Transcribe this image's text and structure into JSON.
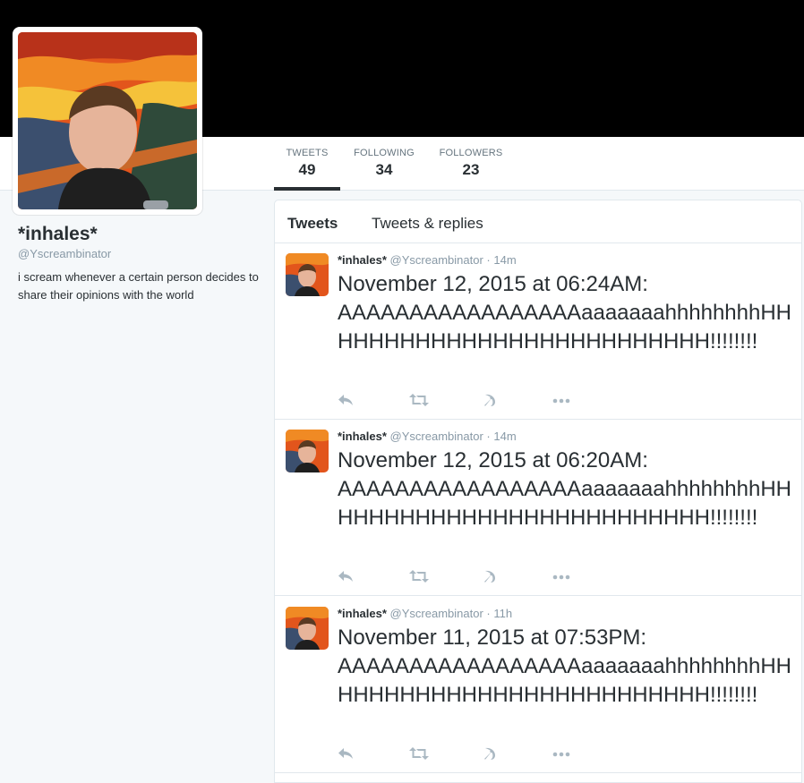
{
  "profile": {
    "name": "*inhales*",
    "handle": "@Yscreambinator",
    "bio": "i scream whenever a certain person decides to share their opinions with the world"
  },
  "stats": [
    {
      "label": "TWEETS",
      "value": "49"
    },
    {
      "label": "FOLLOWING",
      "value": "34"
    },
    {
      "label": "FOLLOWERS",
      "value": "23"
    }
  ],
  "tabs": [
    {
      "label": "Tweets"
    },
    {
      "label": "Tweets & replies"
    }
  ],
  "tweets": [
    {
      "name": "*inhales*",
      "handle": "@Yscreambinator",
      "time": "· 14m",
      "text": "November 12, 2015 at 06:24AM: AAAAAAAAAAAAAAAAAaaaaaaahhhhhhhhHHHHHHHHHHHHHHHHHHHHHHHHHH!!!!!!!!"
    },
    {
      "name": "*inhales*",
      "handle": "@Yscreambinator",
      "time": "· 14m",
      "text": "November 12, 2015 at 06:20AM: AAAAAAAAAAAAAAAAAaaaaaaahhhhhhhhHHHHHHHHHHHHHHHHHHHHHHHHHH!!!!!!!!"
    },
    {
      "name": "*inhales*",
      "handle": "@Yscreambinator",
      "time": "· 11h",
      "text": "November 11, 2015 at 07:53PM: AAAAAAAAAAAAAAAAAaaaaaaahhhhhhhhHHHHHHHHHHHHHHHHHHHHHHHHHH!!!!!!!!"
    }
  ],
  "icons": {
    "reply": "reply-icon",
    "retweet": "retweet-icon",
    "like": "hammer-sickle-icon",
    "more": "more-icon"
  },
  "colors": {
    "header": "#000000",
    "page_bg": "#f5f8fa",
    "text": "#292f33",
    "muted": "#8899a6",
    "icon": "#aab8c2"
  }
}
